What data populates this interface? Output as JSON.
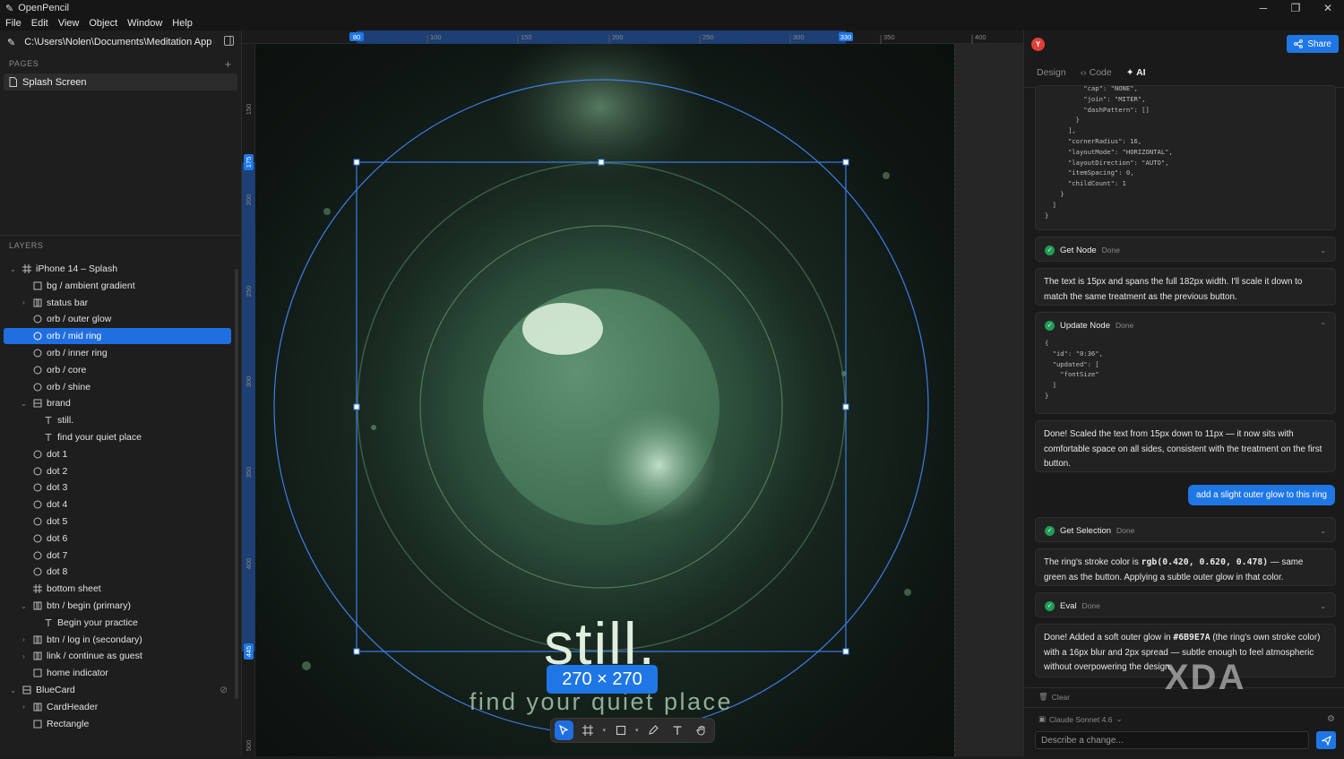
{
  "window": {
    "title": "OpenPencil",
    "controls": [
      "─",
      "❐",
      "✕"
    ]
  },
  "menu": [
    "File",
    "Edit",
    "View",
    "Object",
    "Window",
    "Help"
  ],
  "file": {
    "path": "C:\\Users\\Nolen\\Documents\\Meditation App -..."
  },
  "pages": {
    "header": "PAGES",
    "add": "+",
    "items": [
      "Splash Screen"
    ]
  },
  "layers": {
    "header": "LAYERS",
    "items": [
      {
        "label": "iPhone 14 – Splash",
        "icon": "frame-icon",
        "expand": "open"
      },
      {
        "label": "bg / ambient gradient",
        "icon": "rect-icon",
        "expand": ""
      },
      {
        "label": "status bar",
        "icon": "autolayout-icon",
        "expand": "closed"
      },
      {
        "label": "orb / outer glow",
        "icon": "ellipse-icon",
        "expand": ""
      },
      {
        "label": "orb / mid ring",
        "icon": "ellipse-icon",
        "expand": "",
        "selected": true
      },
      {
        "label": "orb / inner ring",
        "icon": "ellipse-icon",
        "expand": ""
      },
      {
        "label": "orb / core",
        "icon": "ellipse-icon",
        "expand": ""
      },
      {
        "label": "orb / shine",
        "icon": "ellipse-icon",
        "expand": ""
      },
      {
        "label": "brand",
        "icon": "group-icon",
        "expand": "open"
      },
      {
        "label": "still.",
        "icon": "text-icon",
        "expand": "",
        "indent": 2
      },
      {
        "label": "find your quiet place",
        "icon": "text-icon",
        "expand": "",
        "indent": 2
      },
      {
        "label": "dot 1",
        "icon": "ellipse-icon",
        "expand": ""
      },
      {
        "label": "dot 2",
        "icon": "ellipse-icon",
        "expand": ""
      },
      {
        "label": "dot 3",
        "icon": "ellipse-icon",
        "expand": ""
      },
      {
        "label": "dot 4",
        "icon": "ellipse-icon",
        "expand": ""
      },
      {
        "label": "dot 5",
        "icon": "ellipse-icon",
        "expand": ""
      },
      {
        "label": "dot 6",
        "icon": "ellipse-icon",
        "expand": ""
      },
      {
        "label": "dot 7",
        "icon": "ellipse-icon",
        "expand": ""
      },
      {
        "label": "dot 8",
        "icon": "ellipse-icon",
        "expand": ""
      },
      {
        "label": "bottom sheet",
        "icon": "frame-icon",
        "expand": ""
      },
      {
        "label": "btn / begin (primary)",
        "icon": "autolayout-icon",
        "expand": "open"
      },
      {
        "label": "Begin your practice",
        "icon": "text-icon",
        "expand": "",
        "indent": 2
      },
      {
        "label": "btn / log in (secondary)",
        "icon": "autolayout-icon",
        "expand": "closed"
      },
      {
        "label": "link / continue as guest",
        "icon": "autolayout-icon",
        "expand": "closed"
      },
      {
        "label": "home indicator",
        "icon": "rect-icon",
        "expand": ""
      },
      {
        "label": "BlueCard",
        "icon": "group-icon",
        "expand": "open",
        "indent": 0,
        "hidden": true
      },
      {
        "label": "CardHeader",
        "icon": "autolayout-icon",
        "expand": "closed"
      },
      {
        "label": "Rectangle",
        "icon": "rect-icon",
        "expand": ""
      }
    ]
  },
  "rulers": {
    "top": [
      {
        "label": "80",
        "highlight": true
      },
      {
        "label": "100"
      },
      {
        "label": "150"
      },
      {
        "label": "200"
      },
      {
        "label": "250"
      },
      {
        "label": "300"
      },
      {
        "label": "330",
        "highlight": true
      },
      {
        "label": "350"
      },
      {
        "label": "400"
      }
    ],
    "left": [
      {
        "label": "150"
      },
      {
        "label": "175",
        "highlight": true
      },
      {
        "label": "200"
      },
      {
        "label": "250"
      },
      {
        "label": "300"
      },
      {
        "label": "350"
      },
      {
        "label": "400"
      },
      {
        "label": "445",
        "highlight": true
      },
      {
        "label": "500"
      }
    ]
  },
  "canvas": {
    "brand_title": "still.",
    "tagline": "find your quiet place",
    "size_badge": "270 × 270",
    "accent": "#1f77e6",
    "frame_bg": "#0e1512"
  },
  "toolbar": {
    "tools": [
      "select-icon",
      "frame-icon",
      "shape-icon",
      "pen-icon",
      "text-icon",
      "hand-icon"
    ]
  },
  "right": {
    "avatar": "Y",
    "share": "Share",
    "tabs": [
      "Design",
      "Code",
      "AI"
    ],
    "code_snippet": "          \"cap\": \"NONE\",\n          \"join\": \"MITER\",\n          \"dashPattern\": []\n        }\n      ],\n      \"cornerRadius\": 16,\n      \"layoutMode\": \"HORIZONTAL\",\n      \"layoutDirection\": \"AUTO\",\n      \"itemSpacing\": 0,\n      \"childCount\": 1\n    }\n  ]\n}",
    "tool1": {
      "name": "Get Node",
      "status": "Done"
    },
    "msg1": "The text is 15px and spans the full 182px width. I'll scale it down to match the same treatment as the previous button.",
    "tool2": {
      "name": "Update Node",
      "status": "Done",
      "code": "{\n  \"id\": \"0:36\",\n  \"updated\": [\n    \"fontSize\"\n  ]\n}"
    },
    "msg2": "Done! Scaled the text from 15px down to 11px — it now sits with comfortable space on all sides, consistent with the treatment on the first button.",
    "user_msg": "add a slight outer glow to this ring",
    "tool3": {
      "name": "Get Selection",
      "status": "Done"
    },
    "msg3_pre": "The ring's stroke color is",
    "msg3_code": "rgb(0.420, 0.620, 0.478)",
    "msg3_post": "— same green as the button. Applying a subtle outer glow in that color.",
    "tool4": {
      "name": "Eval",
      "status": "Done"
    },
    "msg4_pre": "Done! Added a soft outer glow in",
    "msg4_code": "#6B9E7A",
    "msg4_post": "(the ring's own stroke color) with a 16px blur and 2px spread — subtle enough to feel atmospheric without overpowering the design.",
    "clear": "Clear",
    "model": "Claude Sonnet 4.6",
    "input_placeholder": "Describe a change..."
  },
  "watermark": "XDA"
}
